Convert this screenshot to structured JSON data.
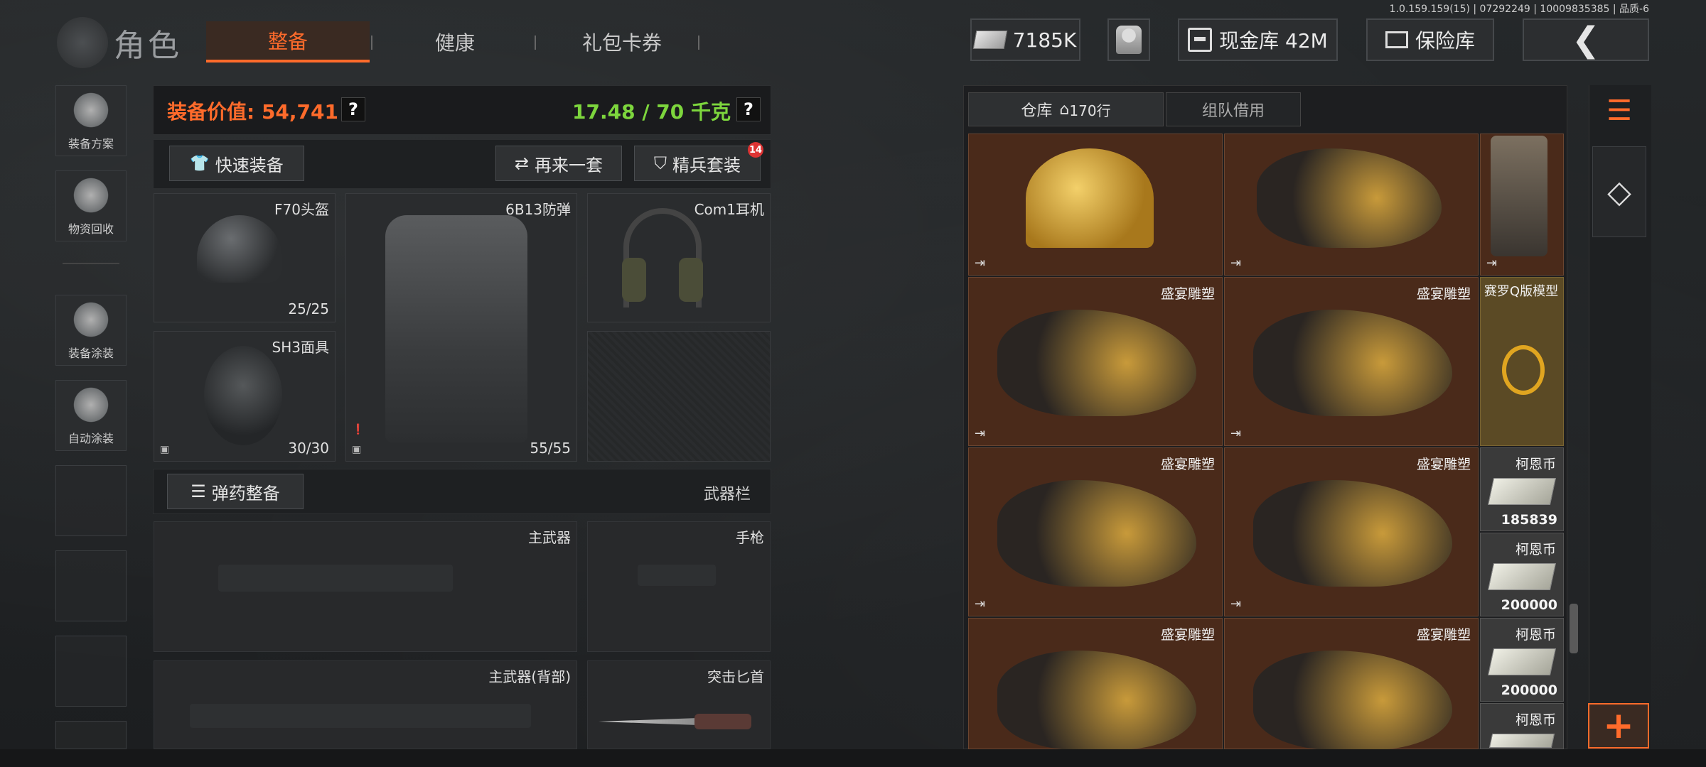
{
  "version": "1.0.159.159(15) | 07292249 | 10009835385 | 品质-6",
  "header": {
    "title": "角色",
    "tabs": [
      {
        "label": "整备",
        "active": true
      },
      {
        "label": "健康",
        "active": false
      },
      {
        "label": "礼包卡券",
        "active": false
      }
    ],
    "money": "7185K",
    "cash_vault": "现金库 42M",
    "insurance": "保险库"
  },
  "sidebar": {
    "items": [
      {
        "label": "装备方案",
        "icon": "loadout-icon"
      },
      {
        "label": "物资回收",
        "icon": "recycle-icon"
      },
      {
        "label": "装备涂装",
        "icon": "paint-icon"
      },
      {
        "label": "自动涂装",
        "icon": "auto-paint-icon"
      }
    ]
  },
  "equipment": {
    "value_label": "装备价值: 54,741",
    "weight_label": "17.48 / 70 千克",
    "help": "?",
    "quick_equip": "快速装备",
    "redo": "再来一套",
    "elite_set": "精兵套装",
    "elite_badge": "14",
    "slots": {
      "helmet": {
        "name": "F70头盔",
        "durability": "25/25"
      },
      "armor": {
        "name": "6B13防弹",
        "durability": "55/55"
      },
      "headset": {
        "name": "Com1耳机"
      },
      "mask": {
        "name": "SH3面具",
        "durability": "30/30"
      }
    },
    "ammo_prep": "弹药整备",
    "weapon_bar": "武器栏",
    "weapons": {
      "primary": "主武器",
      "pistol": "手枪",
      "primary_back": "主武器(背部)",
      "knife": "突击匕首"
    }
  },
  "warehouse": {
    "tab_warehouse": "仓库",
    "rows": "170行",
    "tab_team": "组队借用",
    "items": [
      {
        "title": "盛宴雕塑"
      },
      {
        "title": "赛罗Q版模型"
      },
      {
        "title": "柯恩币",
        "amount": "185839"
      },
      {
        "title": "柯恩币",
        "amount": "200000"
      }
    ]
  },
  "colors": {
    "accent": "#ff6b2b",
    "weight": "#7dd63d",
    "cell_bg": "#4a2a1a"
  }
}
